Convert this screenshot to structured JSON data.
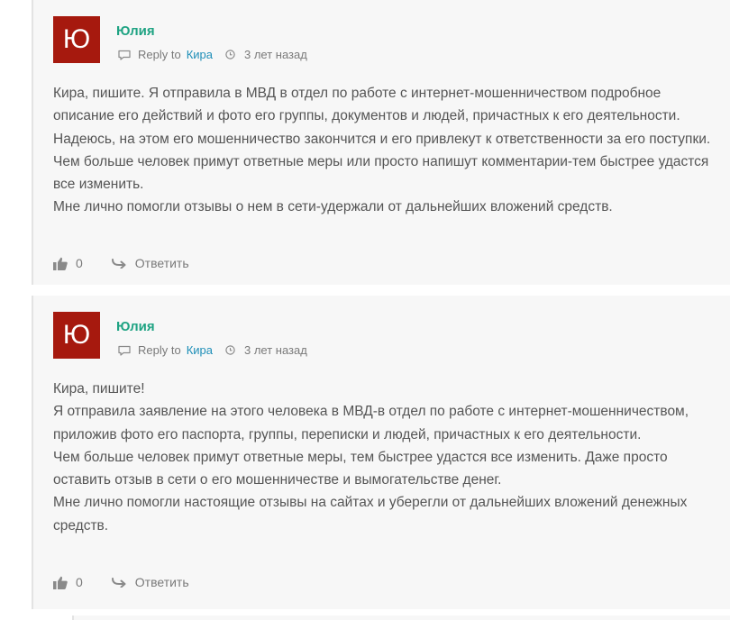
{
  "comments": [
    {
      "avatar_letter": "Ю",
      "author": "Юлия",
      "reply_to_label": "Reply to",
      "reply_to_name": "Кира",
      "time": "3 лет назад",
      "paragraphs": [
        "Кира, пишите. Я отправила в МВД в отдел по работе с интернет-мошенничеством подробное описание его действий и фото его группы, документов и людей, причастных к его деятельности. Надеюсь, на этом его мошенничество закончится и его привлекут к ответственности за его поступки.",
        "Чем больше человек примут ответные меры или просто напишут комментарии-тем быстрее удастся все изменить.",
        "Мне лично помогли отзывы о нем в сети-удержали от дальнейших вложений средств."
      ],
      "likes": "0",
      "reply_label": "Ответить"
    },
    {
      "avatar_letter": "Ю",
      "author": "Юлия",
      "reply_to_label": "Reply to",
      "reply_to_name": "Кира",
      "time": "3 лет назад",
      "paragraphs": [
        "Кира, пишите!",
        "Я отправила заявление на этого человека в МВД-в отдел по работе с интернет-мошенничеством, приложив фото его паспорта, группы, переписки и людей, причастных к его деятельности.",
        "Чем больше человек примут ответные меры, тем быстрее удастся все изменить. Даже просто оставить отзыв в сети о его мошенничестве и вымогательстве денег.",
        "Мне лично помогли настоящие отзывы на сайтах и уберегли от дальнейших вложений денежных средств."
      ],
      "likes": "0",
      "reply_label": "Ответить"
    }
  ],
  "colors": {
    "avatar_bg": "#a6190e",
    "author": "#1fa383",
    "link": "#1f8fb8",
    "text": "#555555",
    "card_bg": "#f7f7f7"
  },
  "icons": [
    "reply-to-icon",
    "clock-icon",
    "thumbs-up-icon",
    "reply-arrow-icon"
  ]
}
